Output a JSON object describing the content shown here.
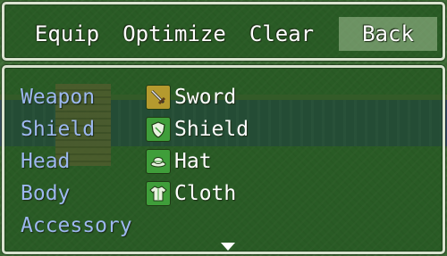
{
  "commands": {
    "equip": "Equip",
    "optimize": "Optimize",
    "clear": "Clear",
    "back": "Back"
  },
  "slots": [
    {
      "label": "Weapon",
      "item": "Sword",
      "icon": "sword-icon",
      "icon_color": "#b59a2e"
    },
    {
      "label": "Shield",
      "item": "Shield",
      "icon": "shield-icon",
      "icon_color": "#3f9e3a"
    },
    {
      "label": "Head",
      "item": "Hat",
      "icon": "hat-icon",
      "icon_color": "#3f9e3a"
    },
    {
      "label": "Body",
      "item": "Cloth",
      "icon": "cloth-icon",
      "icon_color": "#3f9e3a"
    },
    {
      "label": "Accessory",
      "item": "",
      "icon": "",
      "icon_color": ""
    }
  ],
  "colors": {
    "slot_label": "#9db8f0",
    "text": "#ffffff",
    "window_border": "#d9e3cf",
    "selected_command_bg": "#bed7af"
  }
}
